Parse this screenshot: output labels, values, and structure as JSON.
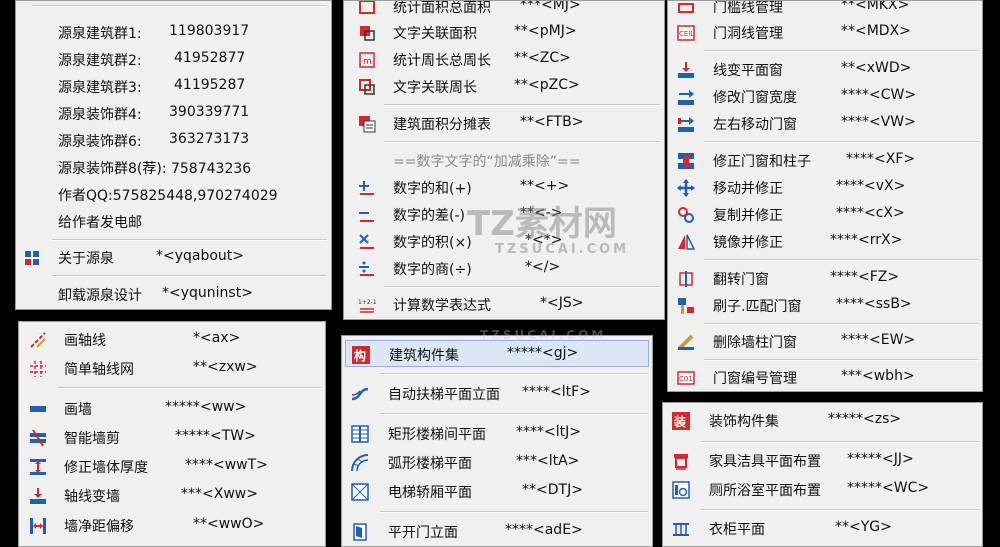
{
  "menus": {
    "yuanquan": {
      "items": [
        {
          "label": "源泉建筑群1:",
          "shortcut": "119803917"
        },
        {
          "label": "源泉建筑群2:",
          "shortcut": "41952877"
        },
        {
          "label": "源泉建筑群3:",
          "shortcut": "41195287"
        },
        {
          "label": "源泉装饰群4:",
          "shortcut": "390339771"
        },
        {
          "label": "源泉装饰群6:",
          "shortcut": "363273173"
        },
        {
          "label": "源泉装饰群8(荐): 758743236",
          "shortcut": ""
        },
        {
          "label": "作者QQ:575825448,970274029",
          "shortcut": ""
        },
        {
          "label": "给作者发电邮",
          "shortcut": ""
        },
        {
          "label": "关于源泉",
          "shortcut": "*<yqabout>"
        },
        {
          "label": "卸载源泉设计",
          "shortcut": "*<yquninst>"
        }
      ]
    },
    "area": {
      "items": [
        {
          "label": "统计面积总面积",
          "shortcut": "***<MJ>"
        },
        {
          "label": "文字关联面积",
          "shortcut": "**<pMJ>"
        },
        {
          "label": "统计周长总周长",
          "shortcut": "**<ZC>"
        },
        {
          "label": "文字关联周长",
          "shortcut": "**<pZC>"
        },
        {
          "label": "建筑面积分摊表",
          "shortcut": "**<FTB>"
        },
        {
          "label": "==数字文字的“加减乘除”==",
          "shortcut": ""
        },
        {
          "label": "数字的和(+)",
          "shortcut": "**<+>"
        },
        {
          "label": "数字的差(-)",
          "shortcut": "**<->"
        },
        {
          "label": "数字的积(×)",
          "shortcut": "*<*>"
        },
        {
          "label": "数字的商(÷)",
          "shortcut": "*</>"
        },
        {
          "label": "计算数学表达式",
          "shortcut": "*<JS>"
        }
      ]
    },
    "door": {
      "items": [
        {
          "label": "门槛线管理",
          "shortcut": "**<MKX>"
        },
        {
          "label": "门洞线管理",
          "shortcut": "**<MDX>"
        },
        {
          "label": "线变平面窗",
          "shortcut": "**<xWD>"
        },
        {
          "label": "修改门窗宽度",
          "shortcut": "****<CW>"
        },
        {
          "label": "左右移动门窗",
          "shortcut": "****<VW>"
        },
        {
          "label": "修正门窗和柱子",
          "shortcut": "****<XF>"
        },
        {
          "label": "移动并修正",
          "shortcut": "****<vX>"
        },
        {
          "label": "复制并修正",
          "shortcut": "****<cX>"
        },
        {
          "label": "镜像并修正",
          "shortcut": "****<rrX>"
        },
        {
          "label": "翻转门窗",
          "shortcut": "****<FZ>"
        },
        {
          "label": "刷子.匹配门窗",
          "shortcut": "****<ssB>"
        },
        {
          "label": "删除墙柱门窗",
          "shortcut": "****<EW>"
        },
        {
          "label": "门窗编号管理",
          "shortcut": "***<wbh>"
        }
      ]
    },
    "axis": {
      "items": [
        {
          "label": "画轴线",
          "shortcut": "*<ax>"
        },
        {
          "label": "简单轴线网",
          "shortcut": "**<zxw>"
        },
        {
          "label": "画墙",
          "shortcut": "*****<ww>"
        },
        {
          "label": "智能墙剪",
          "shortcut": "*****<TW>"
        },
        {
          "label": "修正墙体厚度",
          "shortcut": "****<wwT>"
        },
        {
          "label": "轴线变墙",
          "shortcut": "***<Xww>"
        },
        {
          "label": "墙净距偏移",
          "shortcut": "**<wwO>"
        }
      ]
    },
    "component": {
      "items": [
        {
          "label": "建筑构件集",
          "shortcut": "*****<gj>"
        },
        {
          "label": "自动扶梯平面立面",
          "shortcut": "****<ltF>"
        },
        {
          "label": "矩形楼梯间平面",
          "shortcut": "****<ltJ>"
        },
        {
          "label": "弧形楼梯平面",
          "shortcut": "***<ltA>"
        },
        {
          "label": "电梯轿厢平面",
          "shortcut": "**<DTJ>"
        },
        {
          "label": "平开门立面",
          "shortcut": "****<adE>"
        }
      ]
    },
    "decor": {
      "items": [
        {
          "label": "装饰构件集",
          "shortcut": "*****<zs>"
        },
        {
          "label": "家具洁具平面布置",
          "shortcut": "*****<JJ>"
        },
        {
          "label": "厕所浴室平面布置",
          "shortcut": "*****<WC>"
        },
        {
          "label": "衣柜平面",
          "shortcut": "**<YG>"
        }
      ]
    }
  },
  "watermark": {
    "main": "TZ素材网",
    "sub": "TZSUCAI.COM"
  },
  "icons": [
    "yuanquan-logo-icon",
    "area-stat-icon",
    "text-area-icon",
    "perimeter-icon",
    "text-perimeter-icon",
    "area-table-icon",
    "plus-icon",
    "minus-icon",
    "multiply-icon",
    "divide-icon",
    "expression-icon",
    "door-sill-icon",
    "door-opening-icon",
    "line-to-window-icon",
    "window-width-icon",
    "move-window-icon",
    "fix-window-icon",
    "move-fix-icon",
    "copy-fix-icon",
    "mirror-fix-icon",
    "flip-door-icon",
    "brush-match-icon",
    "delete-wall-icon",
    "door-number-icon",
    "axis-line-icon",
    "axis-grid-icon",
    "wall-icon",
    "wall-trim-icon",
    "wall-thickness-icon",
    "axis-to-wall-icon",
    "wall-offset-icon",
    "component-icon",
    "escalator-icon",
    "rect-stair-icon",
    "arc-stair-icon",
    "elevator-icon",
    "swing-door-icon",
    "decor-icon",
    "furniture-icon",
    "toilet-icon",
    "wardrobe-icon"
  ],
  "colors": {
    "menu_bg": "#f0f0f0",
    "highlight": "#dce7f5",
    "icon_red": "#d8262b",
    "icon_blue": "#1f5fb5"
  }
}
